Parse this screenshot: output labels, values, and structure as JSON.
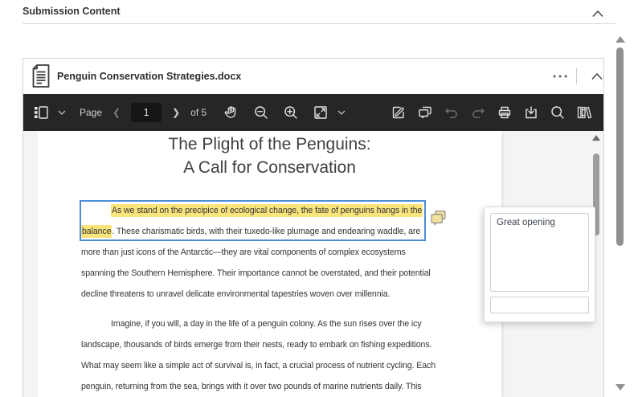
{
  "header": {
    "title": "Submission Content"
  },
  "file_card": {
    "title": "Penguin Conservation Strategies.docx"
  },
  "toolbar": {
    "page_label": "Page",
    "page_value": "1",
    "page_count_label": "of 5"
  },
  "document": {
    "title_lines": [
      "The Plight of the Penguins:",
      "A Call for Conservation"
    ],
    "paragraphs": [
      [
        {
          "indent": true,
          "segments": [
            {
              "text": "As we stand on the precipice of ecological change, the fate of penguins hangs in the",
              "hl": true
            }
          ]
        },
        {
          "segments": [
            {
              "text": "balance",
              "hl": true
            },
            {
              "text": ". These charismatic birds, with their tuxedo-like plumage and endearing waddle, are"
            }
          ]
        },
        {
          "segments": [
            {
              "text": "more than just icons of the Antarctic—they are vital components of complex ecosystems"
            }
          ]
        },
        {
          "segments": [
            {
              "text": "spanning the Southern Hemisphere. Their importance cannot be overstated, and their potential"
            }
          ]
        },
        {
          "segments": [
            {
              "text": "decline threatens to unravel delicate environmental tapestries woven over millennia."
            }
          ]
        }
      ],
      [
        {
          "indent": true,
          "segments": [
            {
              "text": "Imagine, if you will, a day in the life of a penguin colony. As the sun rises over the icy"
            }
          ]
        },
        {
          "segments": [
            {
              "text": "landscape, thousands of birds emerge from their nests, ready to embark on fishing expeditions."
            }
          ]
        },
        {
          "segments": [
            {
              "text": "What may seem like a simple act of survival is, in fact, a crucial process of nutrient cycling. Each"
            }
          ]
        },
        {
          "segments": [
            {
              "text": "penguin, returning from the sea, brings with it over two pounds of marine nutrients daily. This"
            }
          ]
        }
      ]
    ]
  },
  "annotation": {
    "comment_text": "Great opening",
    "reply_placeholder": ""
  },
  "colors": {
    "highlight": "#fae57d",
    "selection_border": "#4e8ed7",
    "toolbar_bg": "#262626",
    "scroll_thumb": "#909090"
  }
}
